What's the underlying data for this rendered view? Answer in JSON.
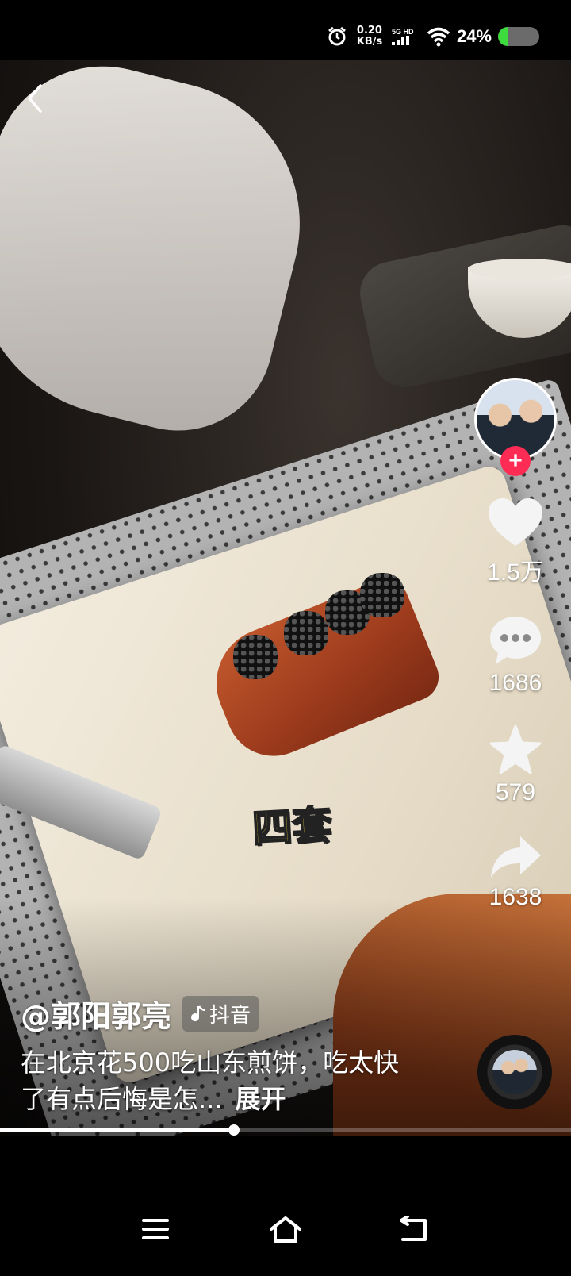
{
  "status_bar": {
    "net_speed_value": "0.20",
    "net_speed_unit": "KB/s",
    "signal_label": "5G HD",
    "battery_percent_text": "24%",
    "battery_level": 0.24,
    "battery_color": "#3ddc3d"
  },
  "video": {
    "caption_overlay": "四套",
    "progress_fraction": 0.41
  },
  "actions": {
    "like_count": "1.5万",
    "comment_count": "1686",
    "favorite_count": "579",
    "share_count": "1638",
    "follow_symbol": "+",
    "accent_color": "#fe2c55"
  },
  "post": {
    "author": "@郭阳郭亮",
    "platform_tag": "抖音",
    "description": "在北京花500吃山东煎饼，吃太快了有点后悔是怎...",
    "expand_label": "展开"
  },
  "icons": {
    "back": "chevron-left-icon",
    "like": "heart-icon",
    "comment": "comment-bubble-icon",
    "favorite": "star-icon",
    "share": "share-arrow-icon",
    "nav_menu": "menu-icon",
    "nav_home": "home-icon",
    "nav_back": "back-icon"
  }
}
